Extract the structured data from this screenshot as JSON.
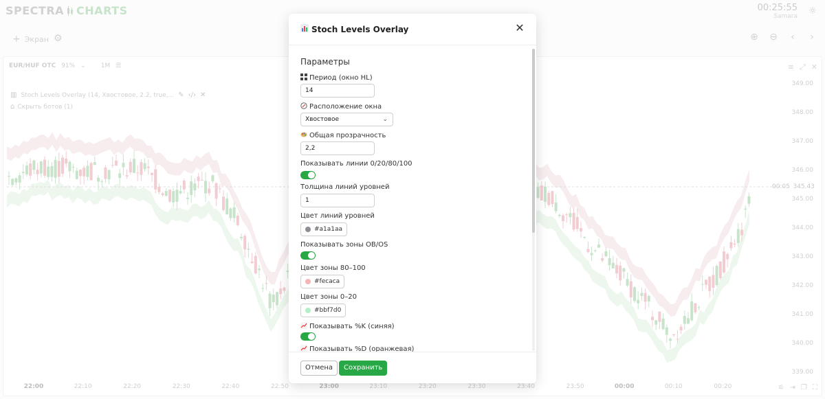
{
  "app": {
    "logo_left": "SPECTRA",
    "logo_right": "CHARTS",
    "time": "00:25:55",
    "city": "Samara"
  },
  "toolbar": {
    "screen_label": "Экран"
  },
  "chart_panel": {
    "pair": "EUR/HUF OTC",
    "payout": "91%",
    "timeframe": "1M",
    "indicator_text": "Stoch Levels Overlay (14, Хвостовое, 2.2, true,...",
    "bots_text": "Скрыть ботов (1)",
    "last_price": "345.43",
    "last_time": "00:05",
    "price_ticks": [
      "349.00",
      "348.00",
      "347.00",
      "346.00",
      "345.00",
      "344.00",
      "343.00",
      "342.00",
      "341.00",
      "340.00",
      "339.00"
    ],
    "time_ticks": [
      {
        "label": "22:00",
        "bold": true
      },
      {
        "label": "22:10",
        "bold": false
      },
      {
        "label": "22:20",
        "bold": false
      },
      {
        "label": "22:30",
        "bold": false
      },
      {
        "label": "22:40",
        "bold": false
      },
      {
        "label": "22:50",
        "bold": false
      },
      {
        "label": "23:00",
        "bold": true
      },
      {
        "label": "23:10",
        "bold": false
      },
      {
        "label": "23:20",
        "bold": false
      },
      {
        "label": "23:30",
        "bold": false
      },
      {
        "label": "23:40",
        "bold": false
      },
      {
        "label": "23:50",
        "bold": false
      },
      {
        "label": "00:00",
        "bold": true
      },
      {
        "label": "00:10",
        "bold": false
      },
      {
        "label": "00:20",
        "bold": false
      }
    ],
    "colors": {
      "up": "#a9d6b0",
      "down": "#eab2b8",
      "zone_upper": "#f3e3e7",
      "zone_lower": "#e3f3e5"
    }
  },
  "modal": {
    "title": "Stoch Levels Overlay",
    "title_icon": "bar-chart-icon",
    "section_title": "Параметры",
    "period_label": "Период (окно HL)",
    "period_value": "14",
    "position_label": "Расположение окна",
    "position_value": "Хвостовое",
    "opacity_label": "Общая прозрачность",
    "opacity_value": "2,2",
    "show_lines_label": "Показывать линии 0/20/80/100",
    "show_lines_on": true,
    "line_width_label": "Толщина линий уровней",
    "line_width_value": "1",
    "line_color_label": "Цвет линий уровней",
    "line_color_value": "#a1a1aa",
    "show_zones_label": "Показывать зоны OB/OS",
    "show_zones_on": true,
    "zone_high_label": "Цвет зоны 80–100",
    "zone_high_value": "#fecaca",
    "zone_low_label": "Цвет зоны 0–20",
    "zone_low_value": "#bbf7d0",
    "show_k_label": "Показывать %K (синяя)",
    "show_k_on": true,
    "show_d_label": "Показывать %D (оранжевая)",
    "cancel_label": "Отмена",
    "save_label": "Сохранить",
    "toggle_color": "#28a745"
  }
}
